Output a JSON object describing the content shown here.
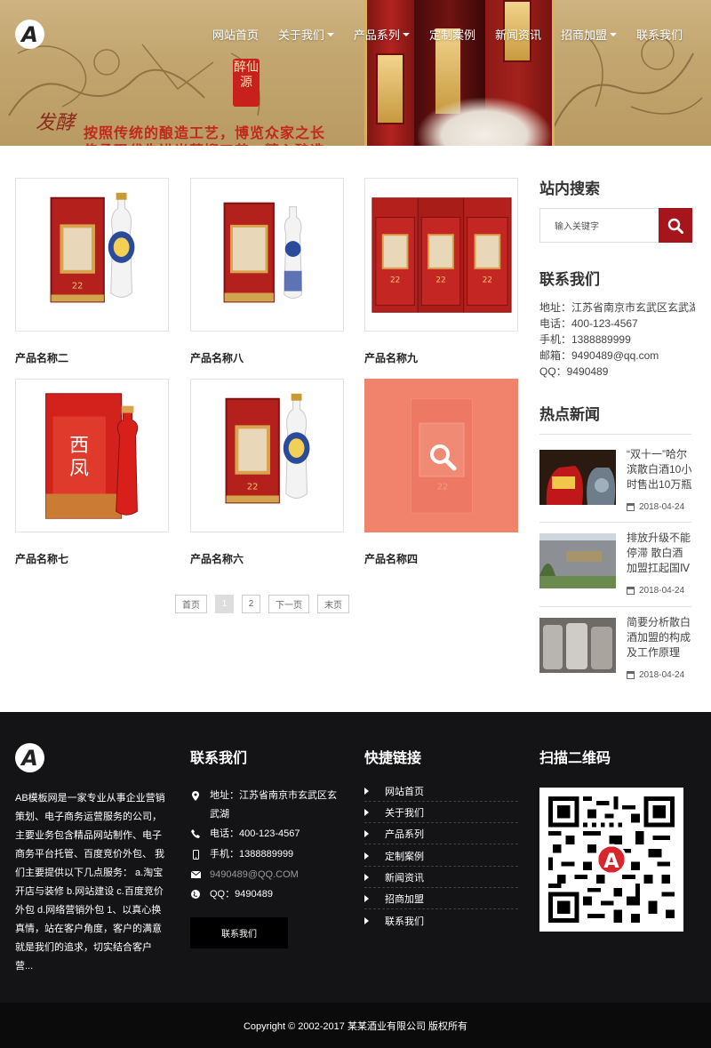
{
  "header": {
    "nav": [
      {
        "label": "网站首页",
        "dropdown": false
      },
      {
        "label": "关于我们",
        "dropdown": true
      },
      {
        "label": "产品系列",
        "dropdown": true
      },
      {
        "label": "定制案例",
        "dropdown": false
      },
      {
        "label": "新闻资讯",
        "dropdown": false
      },
      {
        "label": "招商加盟",
        "dropdown": true
      },
      {
        "label": "联系我们",
        "dropdown": false
      }
    ],
    "banner": {
      "stamp": "醉仙源",
      "slogan": "按照传统的酿造工艺，博览众家之长",
      "slogan_line2": "传承现代先进光蒸馏工艺，精心酿造",
      "calligraphy": "发酵"
    }
  },
  "products": [
    {
      "name": "产品名称二"
    },
    {
      "name": "产品名称八"
    },
    {
      "name": "产品名称九"
    },
    {
      "name": "产品名称七"
    },
    {
      "name": "产品名称六"
    },
    {
      "name": "产品名称四"
    }
  ],
  "pagination": {
    "first": "首页",
    "pages": [
      "1",
      "2"
    ],
    "current": "1",
    "next": "下一页",
    "last": "末页"
  },
  "sidebar": {
    "search_title": "站内搜索",
    "search_placeholder": "输入关键字",
    "contact_title": "联系我们",
    "contact_lines": [
      "地址：江苏省南京市玄武区玄武湖",
      "电话：400-123-4567",
      "手机：1388889999",
      "邮箱：9490489@qq.com",
      "QQ：9490489"
    ],
    "news_title": "热点新闻",
    "news": [
      {
        "title": "“双十一”哈尔滨散白酒10小时售出10万瓶",
        "date": "2018-04-24"
      },
      {
        "title": "排放升级不能停滞 散白酒加盟扛起国Ⅳ环",
        "date": "2018-04-24"
      },
      {
        "title": "简要分析散白酒加盟的构成及工作原理",
        "date": "2018-04-24"
      }
    ]
  },
  "footer": {
    "about": "AB模板网是一家专业从事企业营销策划、电子商务运营服务的公司，主要业务包含精品网站制作、电子商务平台托管、百度竞价外包、 我们主要提供以下几点服务： a.淘宝开店与装修 b.网站建设 c.百度竞价外包 d.网络营销外包 1、以真心换真情，站在客户角度，客户的满意就是我们的追求，切实结合客户营...",
    "contact_title": "联系我们",
    "contact": {
      "address": "地址：江苏省南京市玄武区玄武湖",
      "phone": "电话：400-123-4567",
      "mobile": "手机：1388889999",
      "email": "9490489@QQ.COM",
      "qq": "QQ：9490489"
    },
    "contact_button": "联系我们",
    "links_title": "快捷链接",
    "links": [
      "网站首页",
      "关于我们",
      "产品系列",
      "定制案例",
      "新闻资讯",
      "招商加盟",
      "联系我们"
    ],
    "qr_title": "扫描二维码",
    "copyright": "Copyright © 2002-2017 某某酒业有限公司 版权所有"
  },
  "colors": {
    "accent": "#a7151c",
    "hover_overlay": "#f1826c",
    "footer_bg": "#141416"
  }
}
